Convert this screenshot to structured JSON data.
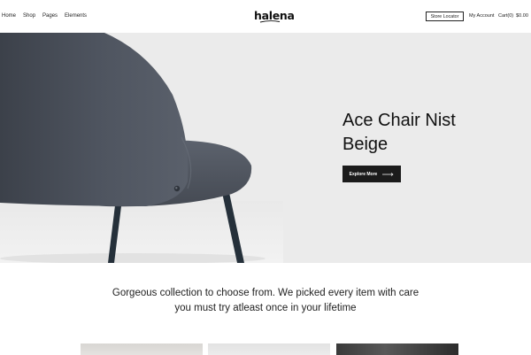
{
  "header": {
    "nav": [
      {
        "label": "Home"
      },
      {
        "label": "Shop"
      },
      {
        "label": "Pages"
      },
      {
        "label": "Elements"
      }
    ],
    "logo": "halena",
    "store_locator": "Store Locator",
    "my_account": "My Account",
    "cart_label": "Cart(0)",
    "cart_total": "$0.00"
  },
  "hero": {
    "title_line1": "Ace Chair Nist",
    "title_line2": "Beige",
    "button_label": "Explore More",
    "image_icon": "chair-image"
  },
  "tagline": {
    "line1": "Gorgeous collection to choose from. We picked every item with care",
    "line2": "you must try atleast once in your lifetime"
  },
  "colors": {
    "hero_bg": "#ebebeb",
    "button_bg": "#1b1b1b",
    "chair_fabric": "#4a4f58",
    "chair_legs": "#25303a"
  }
}
